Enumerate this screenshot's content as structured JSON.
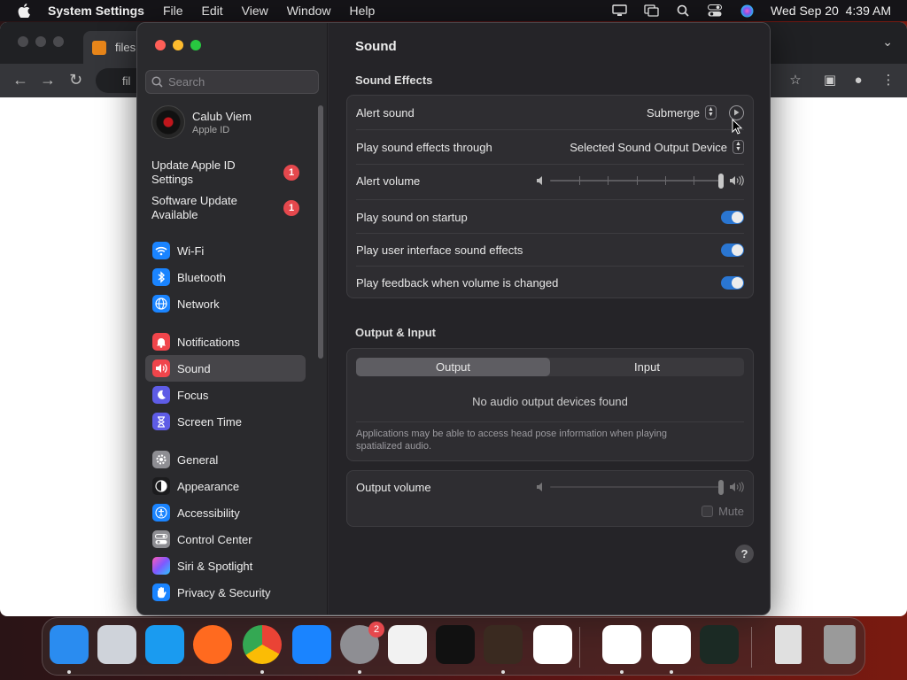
{
  "menubar": {
    "app": "System Settings",
    "items": [
      "File",
      "Edit",
      "View",
      "Window",
      "Help"
    ],
    "datetime": "Wed Sep 20  4:39 AM"
  },
  "browser": {
    "tab_title": "files",
    "url": "fil"
  },
  "sidebar": {
    "search_placeholder": "Search",
    "profile": {
      "name": "Calub Viem",
      "subtitle": "Apple ID"
    },
    "notices": [
      {
        "label": "Update Apple ID Settings",
        "badge": "1"
      },
      {
        "label": "Software Update Available",
        "badge": "1"
      }
    ],
    "items": [
      {
        "label": "Wi-Fi",
        "icon": "wifi-icon",
        "color": "#1a84ff"
      },
      {
        "label": "Bluetooth",
        "icon": "bluetooth-icon",
        "color": "#1a84ff"
      },
      {
        "label": "Network",
        "icon": "globe-icon",
        "color": "#1a84ff"
      },
      {
        "label": "Notifications",
        "icon": "bell-icon",
        "color": "#f0454b"
      },
      {
        "label": "Sound",
        "icon": "speaker-icon",
        "color": "#f0454b"
      },
      {
        "label": "Focus",
        "icon": "moon-icon",
        "color": "#5e5ce6"
      },
      {
        "label": "Screen Time",
        "icon": "hourglass-icon",
        "color": "#5e5ce6"
      },
      {
        "label": "General",
        "icon": "gear-icon",
        "color": "#8e8e93"
      },
      {
        "label": "Appearance",
        "icon": "appearance-icon",
        "color": "#1c1c1e"
      },
      {
        "label": "Accessibility",
        "icon": "accessibility-icon",
        "color": "#1a84ff"
      },
      {
        "label": "Control Center",
        "icon": "control-center-icon",
        "color": "#8e8e93"
      },
      {
        "label": "Siri & Spotlight",
        "icon": "siri-icon",
        "color": "#b04fd6"
      },
      {
        "label": "Privacy & Security",
        "icon": "hand-icon",
        "color": "#1a84ff"
      }
    ],
    "selected": "Sound"
  },
  "main": {
    "title": "Sound",
    "sound_effects": {
      "heading": "Sound Effects",
      "alert_sound_label": "Alert sound",
      "alert_sound_value": "Submerge",
      "play_through_label": "Play sound effects through",
      "play_through_value": "Selected Sound Output Device",
      "alert_volume_label": "Alert volume",
      "alert_volume_level": 1.0,
      "startup_label": "Play sound on startup",
      "startup_on": true,
      "ui_sounds_label": "Play user interface sound effects",
      "ui_sounds_on": true,
      "feedback_label": "Play feedback when volume is changed",
      "feedback_on": true
    },
    "output_input": {
      "heading": "Output & Input",
      "tabs": [
        "Output",
        "Input"
      ],
      "selected_tab": "Output",
      "empty_message": "No audio output devices found",
      "note": "Applications may be able to access head pose information when playing spatialized audio.",
      "output_volume_label": "Output volume",
      "output_volume_level": 1.0,
      "mute_label": "Mute"
    },
    "help": "?"
  },
  "dock": {
    "apps": [
      {
        "name": "finder-app",
        "color": "#2a8cf0"
      },
      {
        "name": "launchpad-app",
        "color": "#cfd3da"
      },
      {
        "name": "safari-app",
        "color": "#1a9bf0"
      },
      {
        "name": "firefox-app",
        "color": "#ff6a1f"
      },
      {
        "name": "chrome-app",
        "color": "#ffffff"
      },
      {
        "name": "app-store-app",
        "color": "#1a84ff"
      },
      {
        "name": "system-settings-app",
        "color": "#8e8e93"
      },
      {
        "name": "textedit-app",
        "color": "#f2f2f2"
      },
      {
        "name": "terminal-app",
        "color": "#111111"
      },
      {
        "name": "garageband-app",
        "color": "#3a2a20"
      },
      {
        "name": "vscode-app",
        "color": "#ffffff"
      },
      {
        "name": "cleanmymac-app",
        "color": "#ffffff"
      },
      {
        "name": "news-app",
        "color": "#ffffff"
      },
      {
        "name": "activity-monitor-app",
        "color": "#1b2a24"
      },
      {
        "name": "archive-file",
        "color": "#e0e0e0"
      },
      {
        "name": "trash",
        "color": "#9a9a9a"
      }
    ],
    "settings_badge": "2"
  }
}
